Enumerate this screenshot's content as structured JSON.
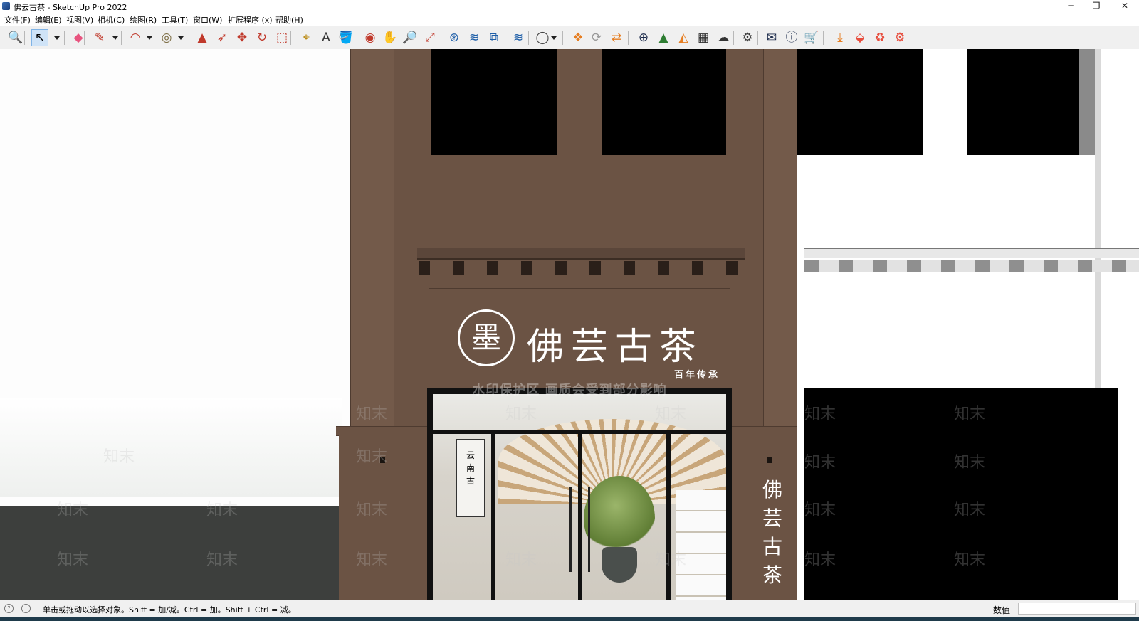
{
  "window": {
    "title": "佛云古茶 - SketchUp Pro 2022",
    "minimize": "─",
    "restore": "❐",
    "close": "✕"
  },
  "menu": [
    "文件(F)",
    "编辑(E)",
    "视图(V)",
    "相机(C)",
    "绘图(R)",
    "工具(T)",
    "窗口(W)",
    "扩展程序 (x)",
    "帮助(H)"
  ],
  "toolbar": {
    "tools": [
      {
        "name": "zoom-extents-icon",
        "glyph": "🔍"
      },
      {
        "name": "select-icon",
        "glyph": "↖",
        "selected": true
      },
      {
        "name": "eraser-icon",
        "glyph": "◆",
        "color": "#e8547f"
      },
      {
        "name": "pencil-line-icon",
        "glyph": "✎",
        "color": "#c0392b"
      },
      {
        "name": "arc-icon",
        "glyph": "◠",
        "color": "#c0392b"
      },
      {
        "name": "circle-icon",
        "glyph": "◎",
        "color": "#7a6a40"
      },
      {
        "name": "push-pull-icon",
        "glyph": "▲",
        "color": "#c0392b"
      },
      {
        "name": "follow-me-icon",
        "glyph": "➶",
        "color": "#c0392b"
      },
      {
        "name": "move-icon",
        "glyph": "✥",
        "color": "#c0392b"
      },
      {
        "name": "rotate-icon",
        "glyph": "↻",
        "color": "#c0392b"
      },
      {
        "name": "scale-icon",
        "glyph": "⬚",
        "color": "#c0392b"
      },
      {
        "name": "tape-measure-icon",
        "glyph": "⌖",
        "color": "#b8860b"
      },
      {
        "name": "text-icon",
        "glyph": "A",
        "color": "#333"
      },
      {
        "name": "paint-bucket-icon",
        "glyph": "🪣",
        "color": "#8a5a2b"
      },
      {
        "name": "orbit-icon",
        "glyph": "◉",
        "color": "#c0392b"
      },
      {
        "name": "pan-icon",
        "glyph": "✋",
        "color": "#b8860b"
      },
      {
        "name": "zoom-icon",
        "glyph": "🔎",
        "color": "#333"
      },
      {
        "name": "zoom-window-icon",
        "glyph": "⤢",
        "color": "#c0392b"
      },
      {
        "name": "add-location-icon",
        "glyph": "⊛",
        "color": "#1f5fa8"
      },
      {
        "name": "toggle-terrain-icon",
        "glyph": "≋",
        "color": "#1f5fa8"
      },
      {
        "name": "photo-textures-icon",
        "glyph": "⧉",
        "color": "#1f5fa8"
      },
      {
        "name": "geo-location-icon",
        "glyph": "≋",
        "color": "#1f5fa8"
      },
      {
        "name": "account-icon",
        "glyph": "◯",
        "color": "#444"
      },
      {
        "name": "extension-manager-icon",
        "glyph": "❖",
        "color": "#e67e22"
      },
      {
        "name": "sync-icon",
        "glyph": "⟳",
        "color": "#999"
      },
      {
        "name": "share-model-icon",
        "glyph": "⇄",
        "color": "#e67e22"
      },
      {
        "name": "add-icon",
        "glyph": "⊕",
        "color": "#1b2a4a"
      },
      {
        "name": "tree-icon",
        "glyph": "▲",
        "color": "#2e7d32"
      },
      {
        "name": "layers-icon",
        "glyph": "◭",
        "color": "#e67e22"
      },
      {
        "name": "grid-icon",
        "glyph": "▦",
        "color": "#333"
      },
      {
        "name": "cloud-upload-icon",
        "glyph": "☁",
        "color": "#333"
      },
      {
        "name": "settings-icon",
        "glyph": "⚙",
        "color": "#333"
      },
      {
        "name": "mail-icon",
        "glyph": "✉",
        "color": "#1b2a4a"
      },
      {
        "name": "info-icon",
        "glyph": "ⓘ",
        "color": "#1b2a4a"
      },
      {
        "name": "cart-icon",
        "glyph": "🛒",
        "color": "#1b2a4a"
      },
      {
        "name": "import-icon",
        "glyph": "⤓",
        "color": "#e67e22"
      },
      {
        "name": "export-icon",
        "glyph": "⬙",
        "color": "#e74c3c"
      },
      {
        "name": "plugin-icon",
        "glyph": "♻",
        "color": "#e74c3c"
      },
      {
        "name": "gear-plugin-icon",
        "glyph": "⚙",
        "color": "#e74c3c"
      }
    ]
  },
  "scene": {
    "signboard": {
      "logo_glyph": "墨",
      "brand": "佛芸古茶",
      "slogan": "百年传承",
      "vertical_brand": [
        "佛",
        "芸",
        "古",
        "茶"
      ]
    },
    "interior_sign": "云\n南\n古",
    "watermark": {
      "banner": "水印保护区  画质会受到部分影响",
      "mark": "知末"
    },
    "colors": {
      "facade": "#6b5344",
      "facade_dark": "#4e3b30",
      "window": "#000000",
      "white_building": "#ffffff",
      "ground": "#3d3f3d"
    }
  },
  "statusbar": {
    "hint": "单击或拖动以选择对象。Shift = 加/减。Ctrl = 加。Shift + Ctrl = 减。",
    "measure_label": "数值",
    "measure_value": ""
  }
}
